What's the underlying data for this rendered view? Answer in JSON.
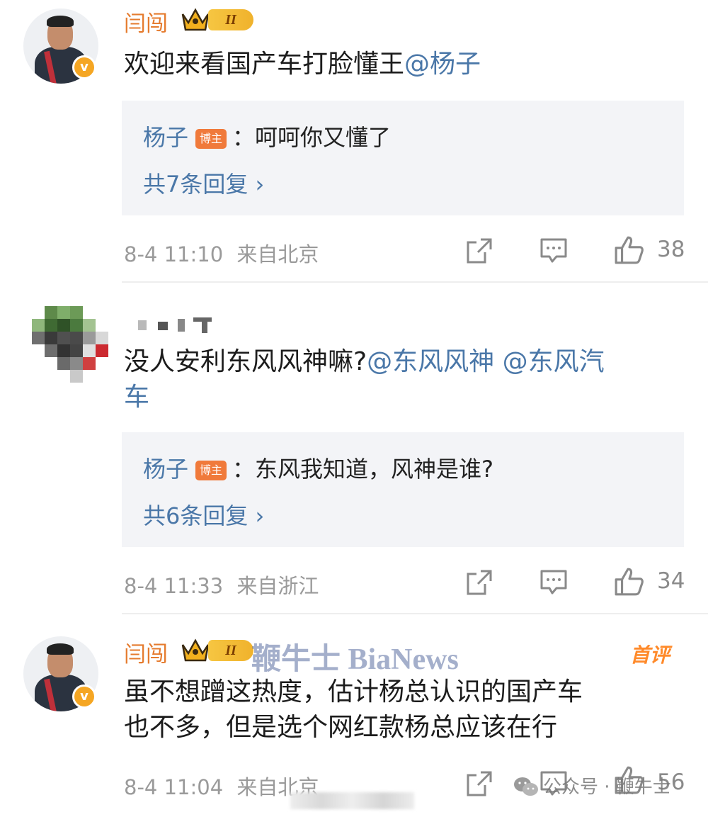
{
  "comments": [
    {
      "username": "闫闯",
      "level_badge": "II",
      "text_prefix": "欢迎来看国产车打脸懂王",
      "mention": "@杨子",
      "reply": {
        "name": "杨子",
        "tag": "博主",
        "text": "：呵呵你又懂了",
        "count": "共7条回复 ›"
      },
      "time": "8-4 11:10",
      "location": "来自北京",
      "likes": "38"
    },
    {
      "text_prefix": "没人安利东风风神嘛?",
      "mention1": "@东风风神",
      "mention2": "@东风汽",
      "mention2_cont": "车",
      "reply": {
        "name": "杨子",
        "tag": "博主",
        "text": "：东风我知道，风神是谁?",
        "count": "共6条回复 ›"
      },
      "time": "8-4 11:33",
      "location": "来自浙江",
      "likes": "34"
    },
    {
      "username": "闫闯",
      "level_badge": "II",
      "first_tag": "首评",
      "line1": "虽不想蹭这热度，估计杨总认识的国产车",
      "line2": "也不多，但是选个网红款杨总应该在行",
      "time": "8-4 11:04",
      "location": "来自北京",
      "likes": "56"
    }
  ],
  "watermarks": {
    "bianews": "鞭牛士 BiaNews",
    "wechat": "公众号 · 鞭牛士"
  },
  "colors": {
    "username": "#e57b2e",
    "mention": "#4a77a8",
    "meta": "#9a9a9a",
    "reply_bg": "#f3f4f7"
  },
  "icons": {
    "verified": "v-badge-icon",
    "repost": "repost-icon",
    "comment": "comment-icon",
    "like": "thumbs-up-icon"
  }
}
